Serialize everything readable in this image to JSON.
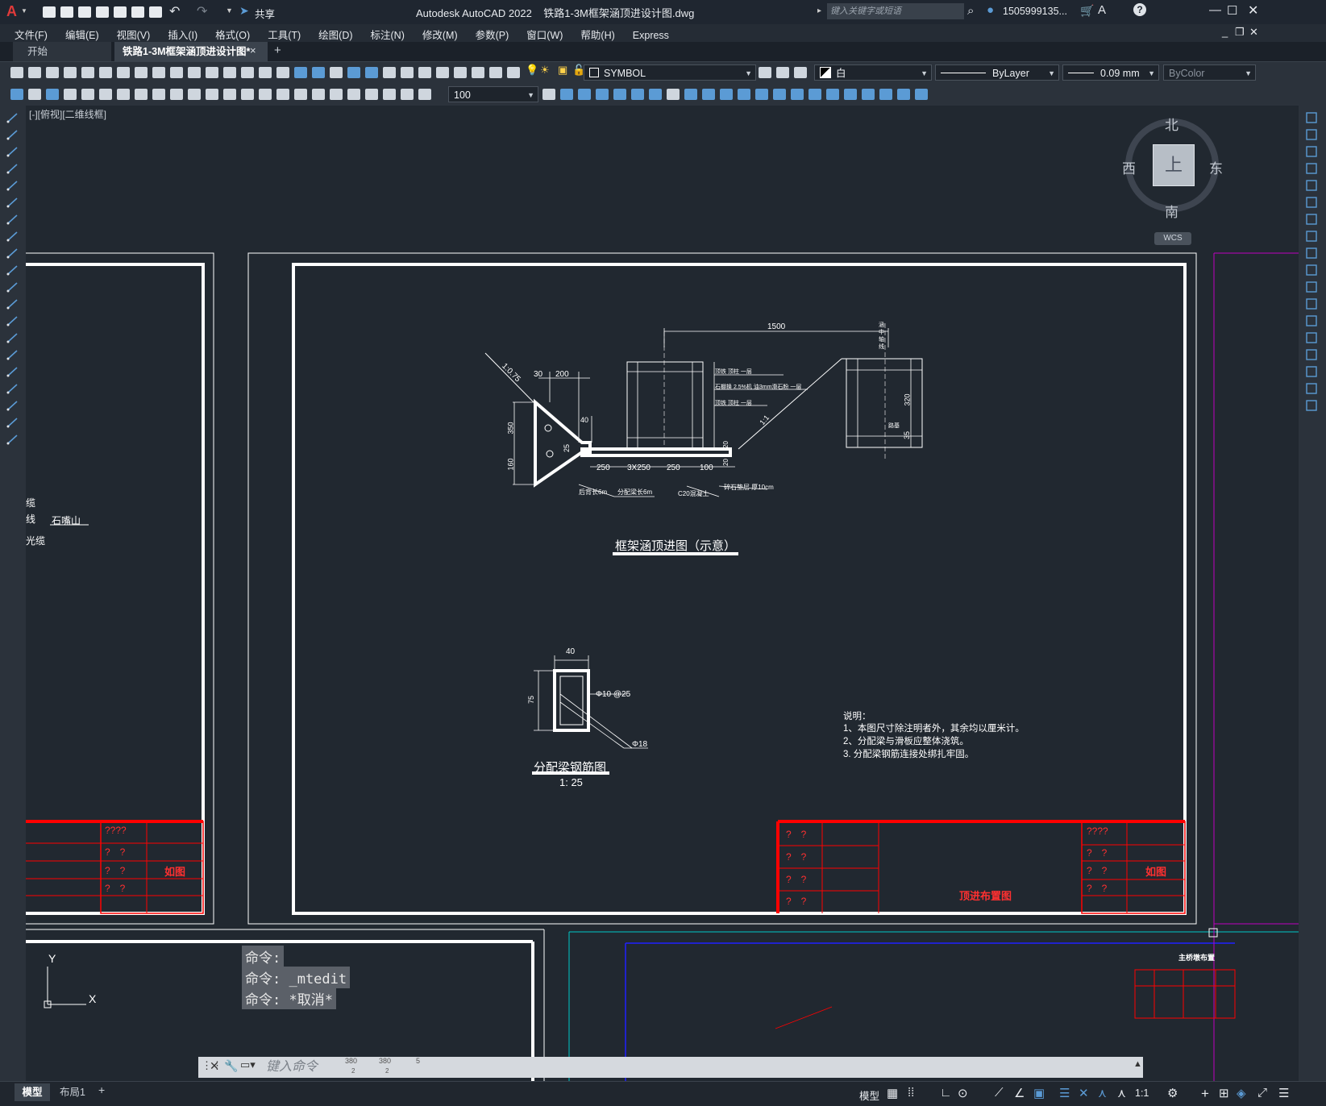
{
  "app": {
    "title": "Autodesk AutoCAD 2022    铁路1-3M框架涵顶进设计图.dwg",
    "share_label": "共享",
    "search_placeholder": "键入关键字或短语",
    "user": "1505999135...",
    "help": "?"
  },
  "menu": [
    "文件(F)",
    "编辑(E)",
    "视图(V)",
    "插入(I)",
    "格式(O)",
    "工具(T)",
    "绘图(D)",
    "标注(N)",
    "修改(M)",
    "参数(P)",
    "窗口(W)",
    "帮助(H)",
    "Express"
  ],
  "tabs": {
    "start": "开始",
    "active": "铁路1-3M框架涵顶进设计图*",
    "close": "×",
    "add": "+"
  },
  "toolbar": {
    "layer": "SYMBOL",
    "color": "白",
    "linetype": "ByLayer",
    "lineweight": "0.09 mm",
    "plotstyle": "ByColor",
    "scale": "100"
  },
  "viewport": {
    "label": "[-][俯视][二维线框]",
    "viewcube": {
      "north": "北",
      "south": "南",
      "east": "东",
      "west": "西",
      "face": "上",
      "wcs": "WCS"
    }
  },
  "drawing": {
    "left_labels": [
      "缆",
      "线",
      "光缆",
      "石嘴山"
    ],
    "main_title": "框架涵顶进图（示意）",
    "beam_title": "分配梁钢筋图",
    "beam_scale": "1: 25",
    "dims_main": [
      "1500",
      "30",
      "200",
      "1:0.75",
      "40",
      "350",
      "160",
      "25",
      "250",
      "3X250",
      "250",
      "100",
      "20",
      "20",
      "1:1",
      "320",
      "35"
    ],
    "notes_main": [
      "后背长6m",
      "分配梁长6m",
      "C20混凝土",
      "碎石垫层 厚10cm",
      "顶铁 顶柱 一层",
      "石棚换 2.5%机 油3mm滑石粉 一层",
      "顶铁 顶柱 一层",
      "涵 中 轴 线",
      "路基"
    ],
    "dims_beam": [
      "40",
      "75",
      "Φ10 @25",
      "Φ18"
    ],
    "explain_title": "说明：",
    "explain_lines": [
      "1、本图尺寸除注明者外，其余均以厘米计。",
      "2、分配梁与滑板应整体浇筑。",
      "3. 分配梁钢筋连接处绑扎牢固。"
    ],
    "titleblock_left": {
      "header": "????",
      "cells": [
        "?　?",
        "?　?",
        "?　?"
      ],
      "figure": "如图"
    },
    "titleblock_right": {
      "header": "????",
      "cells": [
        "?　?",
        "?　?",
        "?　?"
      ],
      "figure": "如图",
      "left_cells": [
        "?　?",
        "?　?",
        "?　?",
        "?　?"
      ],
      "title": "顶进布置图"
    },
    "minimap_title": "主桥墩布置",
    "ucs": {
      "y": "Y",
      "x": "X"
    }
  },
  "command": {
    "history": [
      "命令:",
      "命令: _mtedit",
      "命令: *取消*"
    ],
    "placeholder": "键入命令",
    "dims": [
      "380",
      "380",
      "2",
      "2",
      "5"
    ]
  },
  "layout_tabs": [
    "模型",
    "布局1",
    "+"
  ],
  "status": {
    "model": "模型",
    "scale": "1:1"
  },
  "colors": {
    "accent": "#5b9bd5",
    "red": "#ff0000",
    "canvas": "#212830",
    "magenta": "#c000c0",
    "cyan": "#00c8c8"
  }
}
